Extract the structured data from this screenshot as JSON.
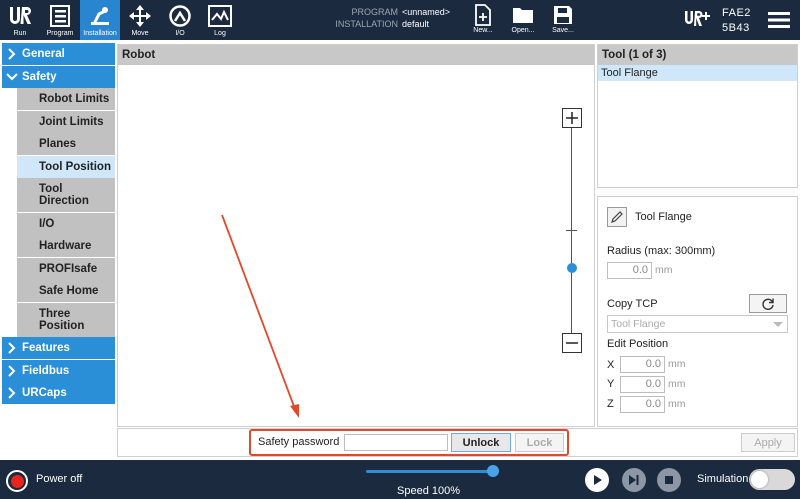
{
  "topbar": {
    "tabs": [
      {
        "label": "Run",
        "icon": "ur-logo-icon"
      },
      {
        "label": "Program",
        "icon": "program-icon"
      },
      {
        "label": "Installation",
        "icon": "installation-icon",
        "active": true
      },
      {
        "label": "Move",
        "icon": "move-icon"
      },
      {
        "label": "I/O",
        "icon": "io-icon"
      },
      {
        "label": "Log",
        "icon": "log-icon"
      }
    ],
    "program_key": "PROGRAM",
    "program_value": "<unnamed>",
    "installation_key": "INSTALLATION",
    "installation_value": "default",
    "file_buttons": [
      {
        "label": "New...",
        "icon": "new-file-icon"
      },
      {
        "label": "Open...",
        "icon": "open-folder-icon"
      },
      {
        "label": "Save...",
        "icon": "save-icon"
      }
    ],
    "robot_id_line1": "FAE2",
    "robot_id_line2": "5B43",
    "accent_color": "#2a85d0",
    "bar_color": "#1b2a3e"
  },
  "nav": {
    "general": "General",
    "safety": "Safety",
    "safety_items": [
      "Robot Limits",
      "Joint Limits",
      "Planes",
      "Tool Position",
      "Tool\nDirection",
      "I/O",
      "Hardware",
      "PROFIsafe",
      "Safe Home",
      "Three\nPosition"
    ],
    "selected_item": "Tool Position",
    "features": "Features",
    "fieldbus": "Fieldbus",
    "urcaps": "URCaps"
  },
  "main": {
    "title": "Robot"
  },
  "tool_list": {
    "title": "Tool (1 of 3)",
    "selected": "Tool Flange"
  },
  "tool_props": {
    "name": "Tool Flange",
    "radius_label": "Radius (max: 300mm)",
    "radius_value": "0.0",
    "unit": "mm",
    "copy_tcp_label": "Copy TCP",
    "copy_dropdown": "Tool Flange",
    "edit_position_label": "Edit Position",
    "axes": [
      {
        "axis": "X",
        "value": "0.0"
      },
      {
        "axis": "Y",
        "value": "0.0"
      },
      {
        "axis": "Z",
        "value": "0.0"
      }
    ]
  },
  "password_bar": {
    "label": "Safety password",
    "unlock": "Unlock",
    "lock": "Lock",
    "apply": "Apply",
    "highlight_color": "#e04a2a"
  },
  "bottombar": {
    "power_label": "Power off",
    "speed_label": "Speed 100%",
    "speed_fraction": 1.0,
    "simulation_label": "Simulation"
  }
}
